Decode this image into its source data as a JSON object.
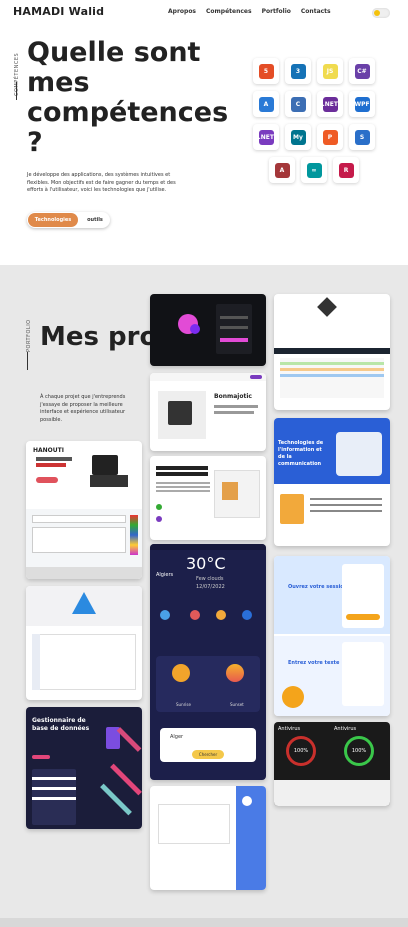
{
  "nav": {
    "brand": "HAMADI Walid",
    "links": [
      "Apropos",
      "Compétences",
      "Portfolio",
      "Contacts"
    ]
  },
  "skills": {
    "vertical_label": "COMPÉTENCES",
    "title": "Quelle sont mes compétences ?",
    "description": "Je développe des applications, des systèmes intuitives et flexibles. Mon objectifs est de faire gagner du temps et des efforts à l'utilisateur, voici les technologies que j'utilise.",
    "tab_active": "Technologies",
    "tab_inactive": "outils",
    "tech_icons": [
      {
        "name": "html5",
        "label": "5",
        "color": "#e44d26"
      },
      {
        "name": "css3",
        "label": "3",
        "color": "#1572b6"
      },
      {
        "name": "javascript",
        "label": "JS",
        "color": "#f0db4f"
      },
      {
        "name": "csharp",
        "label": "C#",
        "color": "#6a40a8"
      },
      {
        "name": "azure",
        "label": "A",
        "color": "#2a7ad6"
      },
      {
        "name": "c",
        "label": "C",
        "color": "#3c6eb4"
      },
      {
        "name": "dotnet",
        "label": ".NET",
        "color": "#6b2d9a"
      },
      {
        "name": "wpf",
        "label": "WPF",
        "color": "#1f6fd0"
      },
      {
        "name": "dotnet-core",
        "label": ".NET",
        "color": "#7a3bbf"
      },
      {
        "name": "mysql",
        "label": "My",
        "color": "#00758f"
      },
      {
        "name": "postman",
        "label": "P",
        "color": "#ef5b25"
      },
      {
        "name": "sql-server",
        "label": "S",
        "color": "#2a6fc9"
      },
      {
        "name": "access",
        "label": "A",
        "color": "#a4373a"
      },
      {
        "name": "arduino",
        "label": "∞",
        "color": "#00979d"
      },
      {
        "name": "raspberry",
        "label": "R",
        "color": "#c51a4a"
      }
    ]
  },
  "projects": {
    "vertical_label": "PORTFOLIO",
    "title": "Mes projets",
    "description": "À chaque projet que j'entreprends j'essaye de proposer la meilleure interface et expérience utilisateur possible.",
    "cards": [
      {
        "id": "login-dark",
        "text": ""
      },
      {
        "id": "table-app",
        "text": ""
      },
      {
        "id": "bonmatjetic",
        "text": "Bonmajotic"
      },
      {
        "id": "technologies",
        "text": "Technologies de l'information et de la communication"
      },
      {
        "id": "hanouti",
        "text": "HANOUTI"
      },
      {
        "id": "weather",
        "temp": "30°C",
        "city": "Algiers",
        "status": "Few clouds",
        "date": "12/07/2022",
        "sunrise": "Sunrise",
        "sunset": "Sunset",
        "search": "Alger",
        "button": "Chercher"
      },
      {
        "id": "connexion",
        "text": "Ouvrez votre session"
      },
      {
        "id": "entrez",
        "text": "Entrez votre texte"
      },
      {
        "id": "bird-app",
        "text": ""
      },
      {
        "id": "gestionnaire",
        "text": "Gestionnaire de base de données"
      },
      {
        "id": "antivirus",
        "text": "Antivirus",
        "pct": "100%"
      },
      {
        "id": "desktop-app",
        "text": ""
      }
    ]
  }
}
